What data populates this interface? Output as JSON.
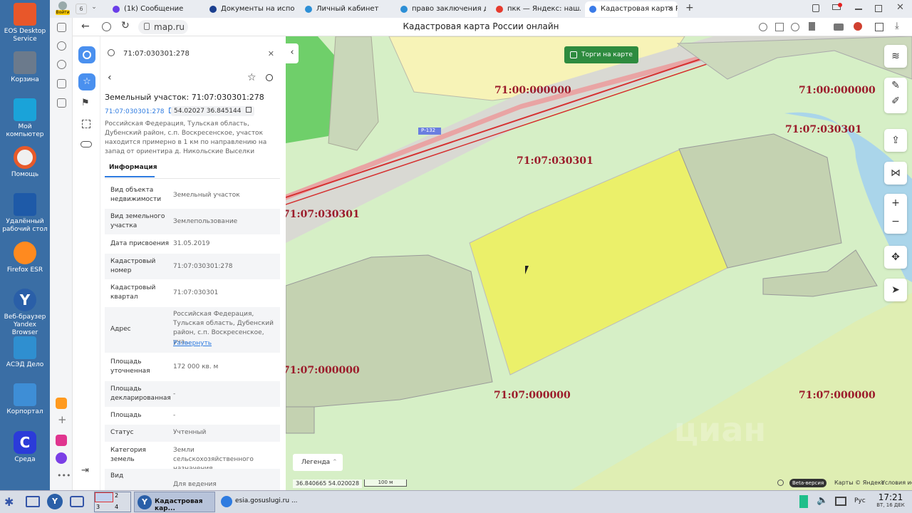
{
  "desktop": {
    "icons": [
      {
        "label": "EOS Desktop Service"
      },
      {
        "label": "Корзина"
      },
      {
        "label": "Мой компьютер"
      },
      {
        "label": "Помощь"
      },
      {
        "label": "Удалённый рабочий стол"
      },
      {
        "label": "Firefox ESR"
      },
      {
        "label": "Веб-браузер Yandex Browser"
      },
      {
        "label": "АСЭД Дело"
      },
      {
        "label": "Корпортал"
      },
      {
        "label": "Среда"
      }
    ]
  },
  "browser": {
    "profile_label": "Войти",
    "tab_count": "6",
    "tabs": [
      {
        "title": "(1k) Сообщение",
        "color": "#6a3ee8"
      },
      {
        "title": "Документы на исполнен",
        "color": "#1b3f8f"
      },
      {
        "title": "Личный кабинет",
        "color": "#2d8fd6"
      },
      {
        "title": "право заключения дого",
        "color": "#2d8fd6"
      },
      {
        "title": "пкк — Яндекс: нашлось",
        "color": "#e63b2e"
      },
      {
        "title": "Кадастровая карта Ро",
        "color": "#3b7be8"
      }
    ],
    "address": "map.ru",
    "page_title": "Кадастровая карта России онлайн"
  },
  "panel": {
    "search_value": "71:07:030301:278",
    "title": "Земельный участок: 71:07:030301:278",
    "number_link": "71:07:030301:278",
    "coords": "54.02027 36.845144",
    "address_full": "Российская Федерация, Тульская область, Дубенский район, с.п. Воскресенское, участок находится примерно в 1 км по направлению на запад от ориентира д. Никольские Выселки",
    "tab_info": "Информация",
    "rows": [
      {
        "k": "Вид объекта недвижимости",
        "v": "Земельный участок"
      },
      {
        "k": "Вид земельного участка",
        "v": "Землепользование"
      },
      {
        "k": "Дата присвоения",
        "v": "31.05.2019"
      },
      {
        "k": "Кадастровый номер",
        "v": "71:07:030301:278"
      },
      {
        "k": "Кадастровый квартал",
        "v": "71:07:030301"
      },
      {
        "k": "Адрес",
        "v": "Российская Федерация, Тульская область, Дубенский район, с.п. Воскресенское, уча..."
      },
      {
        "k": "Площадь уточненная",
        "v": "172 000 кв. м"
      },
      {
        "k": "Площадь декларированная",
        "v": "-"
      },
      {
        "k": "Площадь",
        "v": "-"
      },
      {
        "k": "Статус",
        "v": "Учтенный"
      },
      {
        "k": "Категория земель",
        "v": "Земли сельскохозяйственного назначения"
      },
      {
        "k": "Вид",
        "v": "Для ведения сельскохозяйственного"
      }
    ],
    "expand_link": "Развернуть"
  },
  "map": {
    "auction_label": "Торги на карте",
    "labels": [
      "71:00:000000",
      "71:00:000000",
      "71:07:030301",
      "71:07:030301",
      "71:07:030301",
      "71:07:000000",
      "71:07:000000",
      "71:07:000000"
    ],
    "road_badge": "Р-132",
    "legend": "Легенда",
    "coord_readout": "36.840665  54.020028",
    "scale": "100 м",
    "beta": "Beta-версия",
    "attribution": "Карты © Яндекс",
    "terms": "Условия использования",
    "watermark": "циан",
    "zoom_in": "+",
    "zoom_out": "−"
  },
  "taskbar": {
    "items": [
      {
        "label": "Кадастровая кар..."
      },
      {
        "label": "esia.gosuslugi.ru ..."
      }
    ],
    "lang": "Рус",
    "time": "17:21",
    "date": "ВТ, 16 ДЕК"
  }
}
